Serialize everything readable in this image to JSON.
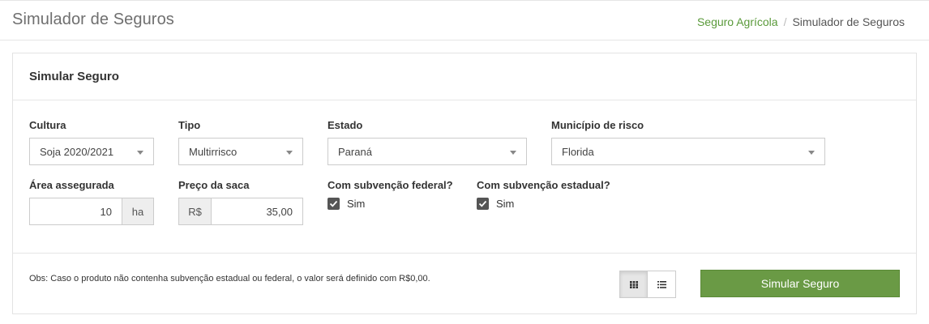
{
  "header": {
    "title": "Simulador de Seguros",
    "breadcrumb": [
      {
        "label": "Seguro Agrícola"
      },
      {
        "label": "Simulador de Seguros"
      }
    ]
  },
  "panel": {
    "title": "Simular Seguro",
    "fields": {
      "cultura": {
        "label": "Cultura",
        "value": "Soja 2020/2021"
      },
      "tipo": {
        "label": "Tipo",
        "value": "Multirrisco"
      },
      "estado": {
        "label": "Estado",
        "value": "Paraná"
      },
      "municipio": {
        "label": "Município de risco",
        "value": "Florida"
      },
      "area": {
        "label": "Área assegurada",
        "value": "10",
        "unit": "ha"
      },
      "preco": {
        "label": "Preço da saca",
        "currency": "R$",
        "value": "35,00"
      },
      "subv_federal": {
        "label": "Com subvenção federal?",
        "option": "Sim",
        "checked": true
      },
      "subv_estadual": {
        "label": "Com subvenção estadual?",
        "option": "Sim",
        "checked": true
      }
    },
    "footer": {
      "note": "Obs: Caso o produto não contenha subvenção estadual ou federal, o valor será definido com R$0,00.",
      "view_toggle": {
        "active": "grid-icon",
        "options": [
          "grid-icon",
          "list-icon"
        ]
      },
      "submit_label": "Simular Seguro"
    }
  },
  "colors": {
    "accent": "#6a9a45",
    "link": "#5a9a3a",
    "checkbox": "#555555"
  }
}
